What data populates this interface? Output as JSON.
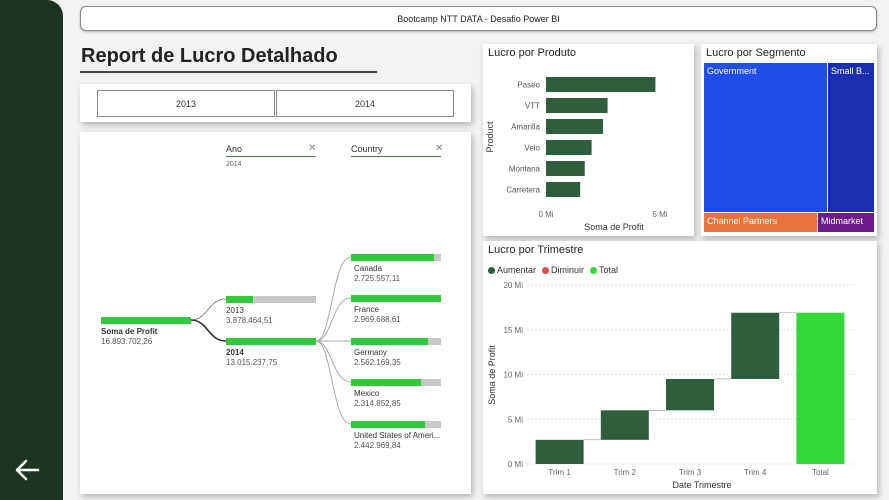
{
  "header": {
    "title": "Bootcamp NTT DATA - Desafio Power BI"
  },
  "page": {
    "title": "Report de Lucro Detalhado"
  },
  "slicer": {
    "options": [
      "2013",
      "2014"
    ]
  },
  "tree": {
    "ano_header": "Ano",
    "ano_sub": "2014",
    "country_header": "Country",
    "root": {
      "label": "Soma de Profit",
      "value": "16.893.702,26"
    },
    "years": [
      {
        "label": "2013",
        "value": "3.878.464,51",
        "fill": 0.3
      },
      {
        "label": "2014",
        "value": "13.015.237,75",
        "fill": 1.0
      }
    ],
    "countries": [
      {
        "label": "Canada",
        "value": "2.725.557,11",
        "fill": 0.92
      },
      {
        "label": "France",
        "value": "2.969.688,61",
        "fill": 1.0
      },
      {
        "label": "Germany",
        "value": "2.562.169,35",
        "fill": 0.86
      },
      {
        "label": "Mexico",
        "value": "2.314.852,85",
        "fill": 0.78
      },
      {
        "label": "United States of Ameri...",
        "value": "2.442.969,84",
        "fill": 0.82
      }
    ]
  },
  "produto": {
    "title": "Lucro por Produto",
    "ylabel": "Product",
    "xlabel": "Soma de Profit",
    "ticks": [
      "0 Mi",
      "5 Mi"
    ]
  },
  "segmento": {
    "title": "Lucro por Segmento",
    "blocks": [
      {
        "label": "Government",
        "color": "#1f4fe8"
      },
      {
        "label": "Small B...",
        "color": "#1a2fb0"
      },
      {
        "label": "Channel Partners",
        "color": "#e8743b"
      },
      {
        "label": "Midmarket",
        "color": "#6d1a8c"
      }
    ]
  },
  "trimestre": {
    "title": "Lucro por Trimestre",
    "legend": [
      {
        "label": "Aumentar",
        "color": "#2e5e3e"
      },
      {
        "label": "Diminuir",
        "color": "#e04a4a"
      },
      {
        "label": "Total",
        "color": "#34d83a"
      }
    ],
    "ylabel": "Soma de Profit",
    "xlabel": "Date Trimestre",
    "yticks": [
      "0 Mi",
      "5 Mi",
      "10 Mi",
      "15 Mi",
      "20 Mi"
    ]
  },
  "chart_data": [
    {
      "type": "bar",
      "title": "Lucro por Produto",
      "xlabel": "Soma de Profit",
      "ylabel": "Product",
      "categories": [
        "Paseo",
        "VTT",
        "Amarilla",
        "Velo",
        "Montana",
        "Carretera"
      ],
      "values": [
        4.8,
        2.7,
        2.5,
        2.0,
        1.7,
        1.5
      ],
      "xlim": [
        0,
        5.3
      ],
      "orientation": "horizontal"
    },
    {
      "type": "bar",
      "title": "Lucro por Trimestre",
      "subtype": "waterfall",
      "xlabel": "Date Trimestre",
      "ylabel": "Soma de Profit",
      "categories": [
        "Trim 1",
        "Trim 2",
        "Trim 3",
        "Trim 4",
        "Total"
      ],
      "starts": [
        0,
        2.7,
        6.0,
        9.5,
        0
      ],
      "ends": [
        2.7,
        6.0,
        9.5,
        16.9,
        16.9
      ],
      "kinds": [
        "Aumentar",
        "Aumentar",
        "Aumentar",
        "Aumentar",
        "Total"
      ],
      "ylim": [
        0,
        20
      ]
    }
  ]
}
